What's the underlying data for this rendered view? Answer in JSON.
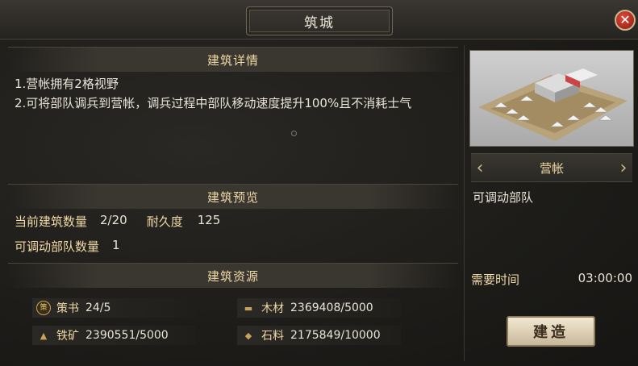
{
  "window": {
    "title": "筑城",
    "close_label": "✕"
  },
  "details": {
    "header": "建筑详情",
    "lines": [
      "1.营帐拥有2格视野",
      "2.可将部队调兵到营帐，调兵过程中部队移动速度提升100%且不消耗士气"
    ]
  },
  "preview_section": {
    "header": "建筑预览",
    "count_label": "当前建筑数量",
    "count_value": "2/20",
    "durability_label": "耐久度",
    "durability_value": "125",
    "troops_label": "可调动部队数量",
    "troops_value": "1"
  },
  "resources": {
    "header": "建筑资源",
    "items": [
      {
        "icon": "book-icon",
        "label": "策书",
        "value": "24/5",
        "glyph": "策"
      },
      {
        "icon": "wood-icon",
        "label": "木材",
        "value": "2369408/5000",
        "glyph": "▬"
      },
      {
        "icon": "iron-icon",
        "label": "铁矿",
        "value": "2390551/5000",
        "glyph": "▲"
      },
      {
        "icon": "stone-icon",
        "label": "石料",
        "value": "2175849/10000",
        "glyph": "◆"
      }
    ]
  },
  "building": {
    "name": "营帐",
    "description": "可调动部队",
    "time_label": "需要时间",
    "time_value": "03:00:00",
    "build_button": "建造"
  },
  "colors": {
    "accent_gold": "#f0d9a6",
    "close_red": "#c0392b"
  }
}
